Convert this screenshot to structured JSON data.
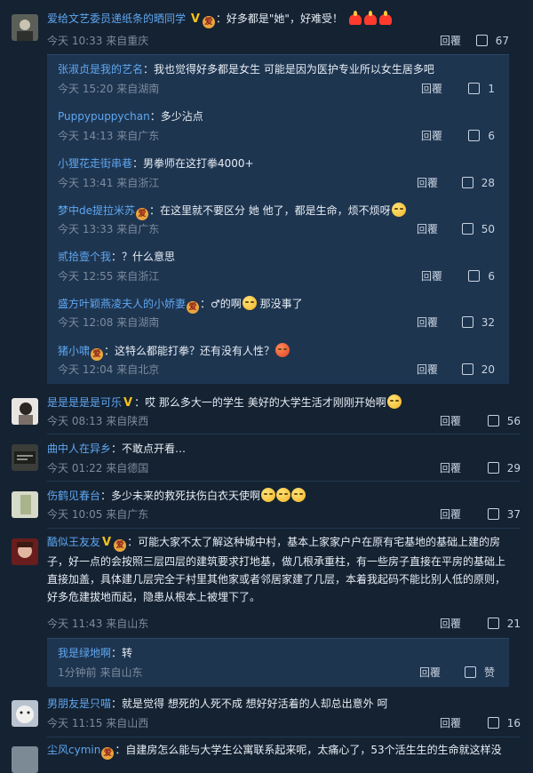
{
  "comments": [
    {
      "user": "爱给文艺委员递纸条的晒同学",
      "text": "：好多都是\"她\"，好难受！",
      "time": "今天 10:33 来自重庆",
      "reply": "回覆",
      "likes": "67",
      "subreplies": [
        {
          "user": "张淑贞是我的艺名",
          "text": "：我也觉得好多都是女生 可能是因为医护专业所以女生居多吧",
          "time": "今天 15:20 来自湖南",
          "reply": "回覆",
          "likes": "1"
        },
        {
          "user": "Puppypuppychan",
          "text": "：多少沾点",
          "time": "今天 14:13 来自广东",
          "reply": "回覆",
          "likes": "6"
        },
        {
          "user": "小狸花走街串巷",
          "text": "：男拳师在这打拳4000+",
          "time": "今天 13:41 来自浙江",
          "reply": "回覆",
          "likes": "28"
        },
        {
          "user": "梦中de提拉米苏",
          "text": "：在这里就不要区分 她 他了，都是生命，烦不烦呀",
          "time": "今天 13:33 来自广东",
          "reply": "回覆",
          "likes": "50"
        },
        {
          "user": "贰拾壹个我",
          "text": "：？什么意思",
          "time": "今天 12:55 来自浙江",
          "reply": "回覆",
          "likes": "6"
        },
        {
          "user": "盛方叶颖燕凌夫人的小娇妻",
          "text": "：♂的啊",
          "text2": "那没事了",
          "time": "今天 12:08 来自湖南",
          "reply": "回覆",
          "likes": "32"
        },
        {
          "user": "猪小啸",
          "text": "：这特么都能打拳？还有没有人性？",
          "time": "今天 12:04 来自北京",
          "reply": "回覆",
          "likes": "20"
        }
      ]
    },
    {
      "user": "是是是是是可乐",
      "text": "：哎 那么多大一的学生 美好的大学生活才刚刚开始啊",
      "time": "今天 08:13 来自陕西",
      "reply": "回覆",
      "likes": "56"
    },
    {
      "user": "曲中人在异乡",
      "text": "：不敢点开看…",
      "time": "今天 01:22 来自德国",
      "reply": "回覆",
      "likes": "29"
    },
    {
      "user": "伤鹤见春台",
      "text": "：多少未来的救死扶伤白衣天使啊",
      "time": "今天 10:05 来自广东",
      "reply": "回覆",
      "likes": "37"
    },
    {
      "user": "酷似王友友",
      "text_lines": [
        "：可能大家不太了解这种城中村，基本上家家户户在原有宅基地的基础上建的房",
        "子，好一点的会按照三层四层的建筑要求打地基，做几根承重柱，有一些房子直接在平房的基础上",
        "直接加盖，具体建几层完全于村里其他家或者邻居家建了几层，本着我起码不能比别人低的原则，",
        "好多危建拔地而起，隐患从根本上被埋下了。"
      ],
      "time": "今天 11:43 来自山东",
      "reply": "回覆",
      "likes": "21",
      "subreplies": [
        {
          "user": "我是绿地啊",
          "text": "：转",
          "time": "1分钟前 来自山东",
          "reply": "回覆",
          "likes": "赞"
        }
      ]
    },
    {
      "user": "男朋友是只喵",
      "text": "：就是觉得 想死的人死不成 想好好活着的人却总出意外 呵",
      "time": "今天 11:15 来自山西",
      "reply": "回覆",
      "likes": "16"
    },
    {
      "user": "尘风cymin",
      "text": "：自建房怎么能与大学生公寓联系起来呢，太痛心了，53个活生生的生命就这样没"
    }
  ]
}
